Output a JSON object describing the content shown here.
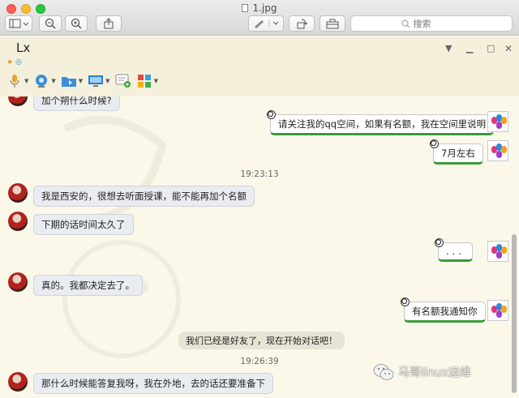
{
  "window": {
    "title": "1.jpg",
    "search_placeholder": "搜索"
  },
  "chat_window": {
    "contact_name": "Lx",
    "status_icons": "★",
    "toolbar_items": [
      "voice-call",
      "video-call",
      "send-file",
      "remote-desktop",
      "new-group",
      "apps"
    ]
  },
  "messages": {
    "partial_top": "加个朔什么时候?",
    "r1": "请关注我的qq空间，如果有名额，我在空间里说明",
    "r2": "7月左右",
    "ts1": "19:23:13",
    "l1": "我是西安的，很想去听面授课，能不能再加个名额",
    "l2": "下期的话时间太久了",
    "r3": "...",
    "l3": "真的。我都决定去了。",
    "r4": "有名额我通知你",
    "system": "我们已经是好友了，现在开始对话吧！",
    "ts2": "19:26:39",
    "l4": "那什么时候能答复我呀，我在外地，去的话还要准备下"
  },
  "watermark": {
    "text": "马哥linux运维"
  },
  "colors": {
    "chat_bg": "#fbf8ea",
    "header_bg": "#f4f0dc",
    "sent_underline": "#3a9a3a",
    "received_bubble": "#e9ecf1"
  }
}
